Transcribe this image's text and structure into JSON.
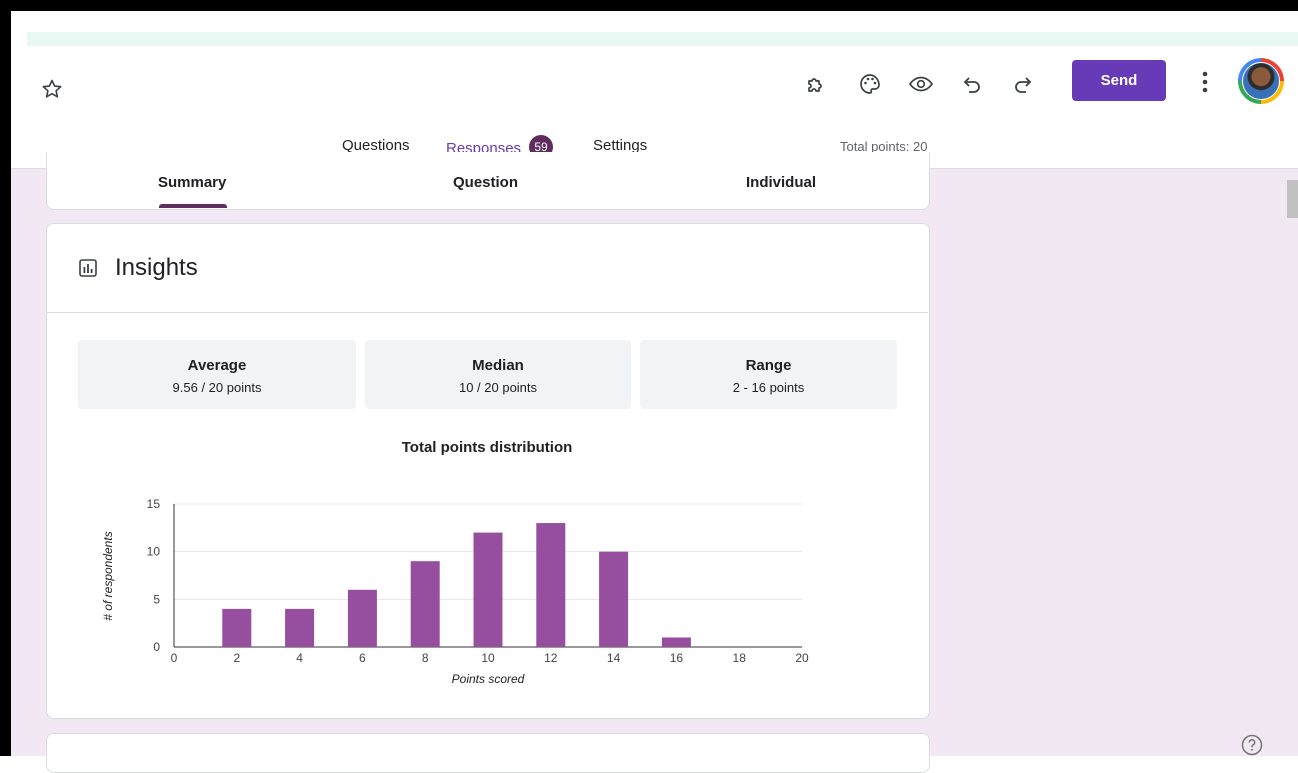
{
  "header": {
    "send_label": "Send",
    "icons": [
      "star-icon",
      "puzzle-icon",
      "palette-icon",
      "eye-icon",
      "undo-icon",
      "redo-icon",
      "more-vert-icon"
    ],
    "accent_color": "#673ab7"
  },
  "tabs": {
    "questions": "Questions",
    "responses": "Responses",
    "responses_count": "59",
    "settings": "Settings",
    "total_points": "Total points: 20"
  },
  "subtabs": {
    "summary": "Summary",
    "question": "Question",
    "individual": "Individual"
  },
  "insights": {
    "title": "Insights",
    "stats": [
      {
        "label": "Average",
        "value": "9.56 / 20 points"
      },
      {
        "label": "Median",
        "value": "10 / 20 points"
      },
      {
        "label": "Range",
        "value": "2 - 16 points"
      }
    ]
  },
  "chart_data": {
    "type": "bar",
    "title": "Total points distribution",
    "xlabel": "Points scored",
    "ylabel": "# of respondents",
    "x": [
      2,
      4,
      6,
      8,
      10,
      12,
      14,
      16
    ],
    "values": [
      4,
      4,
      6,
      9,
      12,
      13,
      10,
      1
    ],
    "xticks": [
      0,
      2,
      4,
      6,
      8,
      10,
      12,
      14,
      16,
      18,
      20
    ],
    "yticks": [
      0,
      5,
      10,
      15
    ],
    "xlim": [
      0,
      20
    ],
    "ylim": [
      0,
      15
    ],
    "bar_color": "#954f9e",
    "grid": true
  }
}
